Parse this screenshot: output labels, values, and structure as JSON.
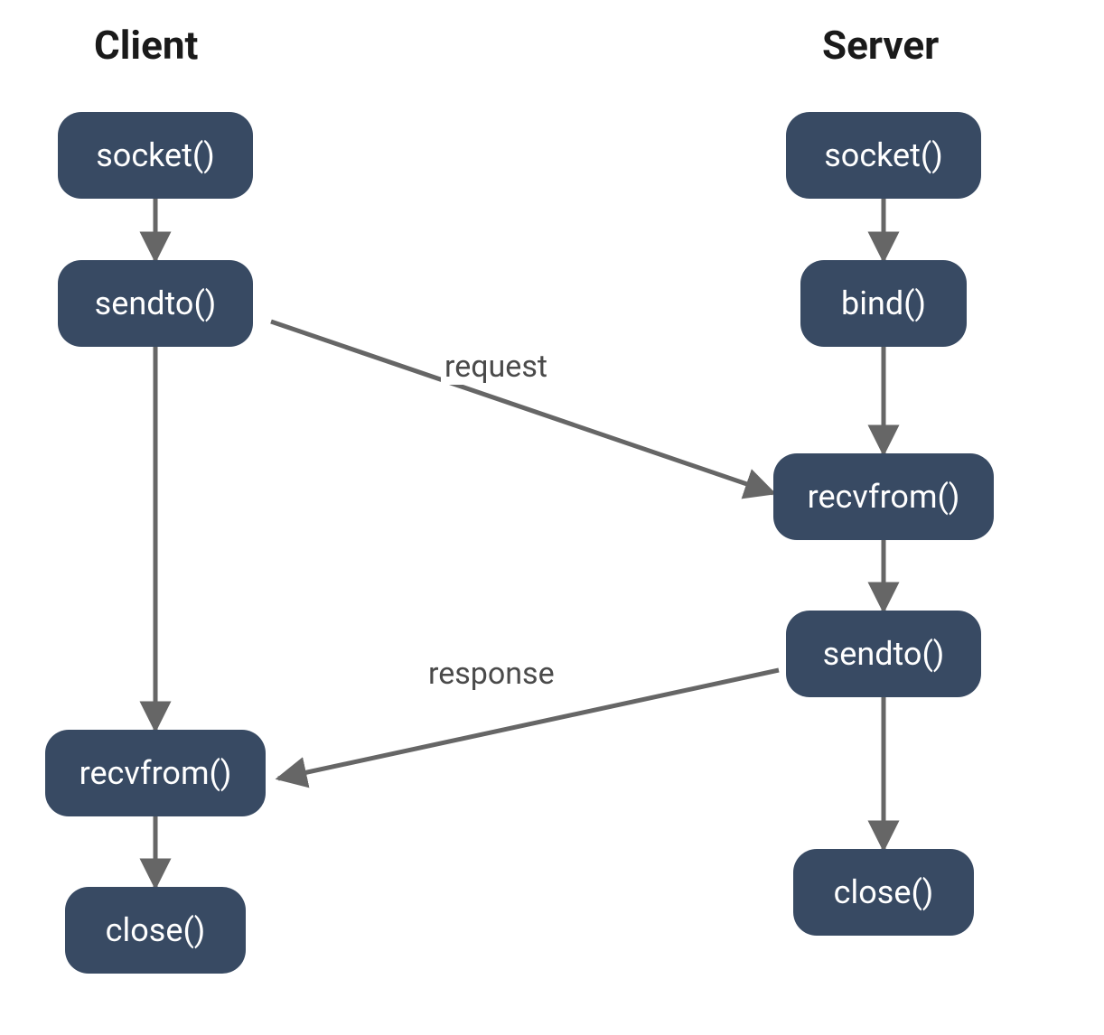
{
  "titles": {
    "client": "Client",
    "server": "Server"
  },
  "client": {
    "socket": "socket()",
    "sendto": "sendto()",
    "recvfrom": "recvfrom()",
    "close": "close()"
  },
  "server": {
    "socket": "socket()",
    "bind": "bind()",
    "recvfrom": "recvfrom()",
    "sendto": "sendto()",
    "close": "close()"
  },
  "labels": {
    "request": "request",
    "response": "response"
  },
  "colors": {
    "node_bg": "#384a63",
    "node_fg": "#ffffff",
    "arrow": "#666666",
    "text": "#1a1a1a"
  },
  "chart_data": {
    "type": "diagram",
    "title": "UDP client–server socket API flow",
    "columns": [
      "Client",
      "Server"
    ],
    "nodes": [
      {
        "id": "c_socket",
        "col": "Client",
        "label": "socket()"
      },
      {
        "id": "c_sendto",
        "col": "Client",
        "label": "sendto()"
      },
      {
        "id": "c_recvfrom",
        "col": "Client",
        "label": "recvfrom()"
      },
      {
        "id": "c_close",
        "col": "Client",
        "label": "close()"
      },
      {
        "id": "s_socket",
        "col": "Server",
        "label": "socket()"
      },
      {
        "id": "s_bind",
        "col": "Server",
        "label": "bind()"
      },
      {
        "id": "s_recvfrom",
        "col": "Server",
        "label": "recvfrom()"
      },
      {
        "id": "s_sendto",
        "col": "Server",
        "label": "sendto()"
      },
      {
        "id": "s_close",
        "col": "Server",
        "label": "close()"
      }
    ],
    "edges": [
      {
        "from": "c_socket",
        "to": "c_sendto"
      },
      {
        "from": "c_sendto",
        "to": "c_recvfrom"
      },
      {
        "from": "c_recvfrom",
        "to": "c_close"
      },
      {
        "from": "s_socket",
        "to": "s_bind"
      },
      {
        "from": "s_bind",
        "to": "s_recvfrom"
      },
      {
        "from": "s_recvfrom",
        "to": "s_sendto"
      },
      {
        "from": "s_sendto",
        "to": "s_close"
      },
      {
        "from": "c_sendto",
        "to": "s_recvfrom",
        "label": "request"
      },
      {
        "from": "s_sendto",
        "to": "c_recvfrom",
        "label": "response"
      }
    ]
  }
}
